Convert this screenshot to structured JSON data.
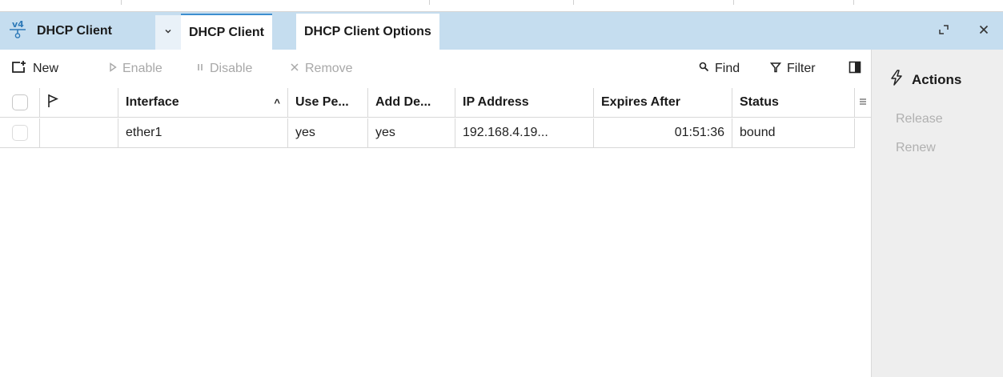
{
  "window": {
    "title": "DHCP Client",
    "tabs": [
      {
        "label": "DHCP Client",
        "active": true
      },
      {
        "label": "DHCP Client Options",
        "active": false
      }
    ]
  },
  "toolbar": {
    "new_label": "New",
    "enable_label": "Enable",
    "disable_label": "Disable",
    "remove_label": "Remove",
    "find_label": "Find",
    "filter_label": "Filter"
  },
  "table": {
    "columns": [
      "Interface",
      "Use Pe...",
      "Add De...",
      "IP Address",
      "Expires After",
      "Status"
    ],
    "sort_indicator": "^",
    "rows": [
      {
        "interface": "ether1",
        "use_peer": "yes",
        "add_default": "yes",
        "ip_address": "192.168.4.19...",
        "expires_after": "01:51:36",
        "status": "bound"
      }
    ]
  },
  "actions": {
    "title": "Actions",
    "items": [
      "Release",
      "Renew"
    ]
  },
  "colors": {
    "titlebar_bg": "#c5ddef",
    "active_tab_accent": "#3d8fd0",
    "actions_bg": "#eeeeee",
    "disabled_text": "#a8a8a8"
  }
}
